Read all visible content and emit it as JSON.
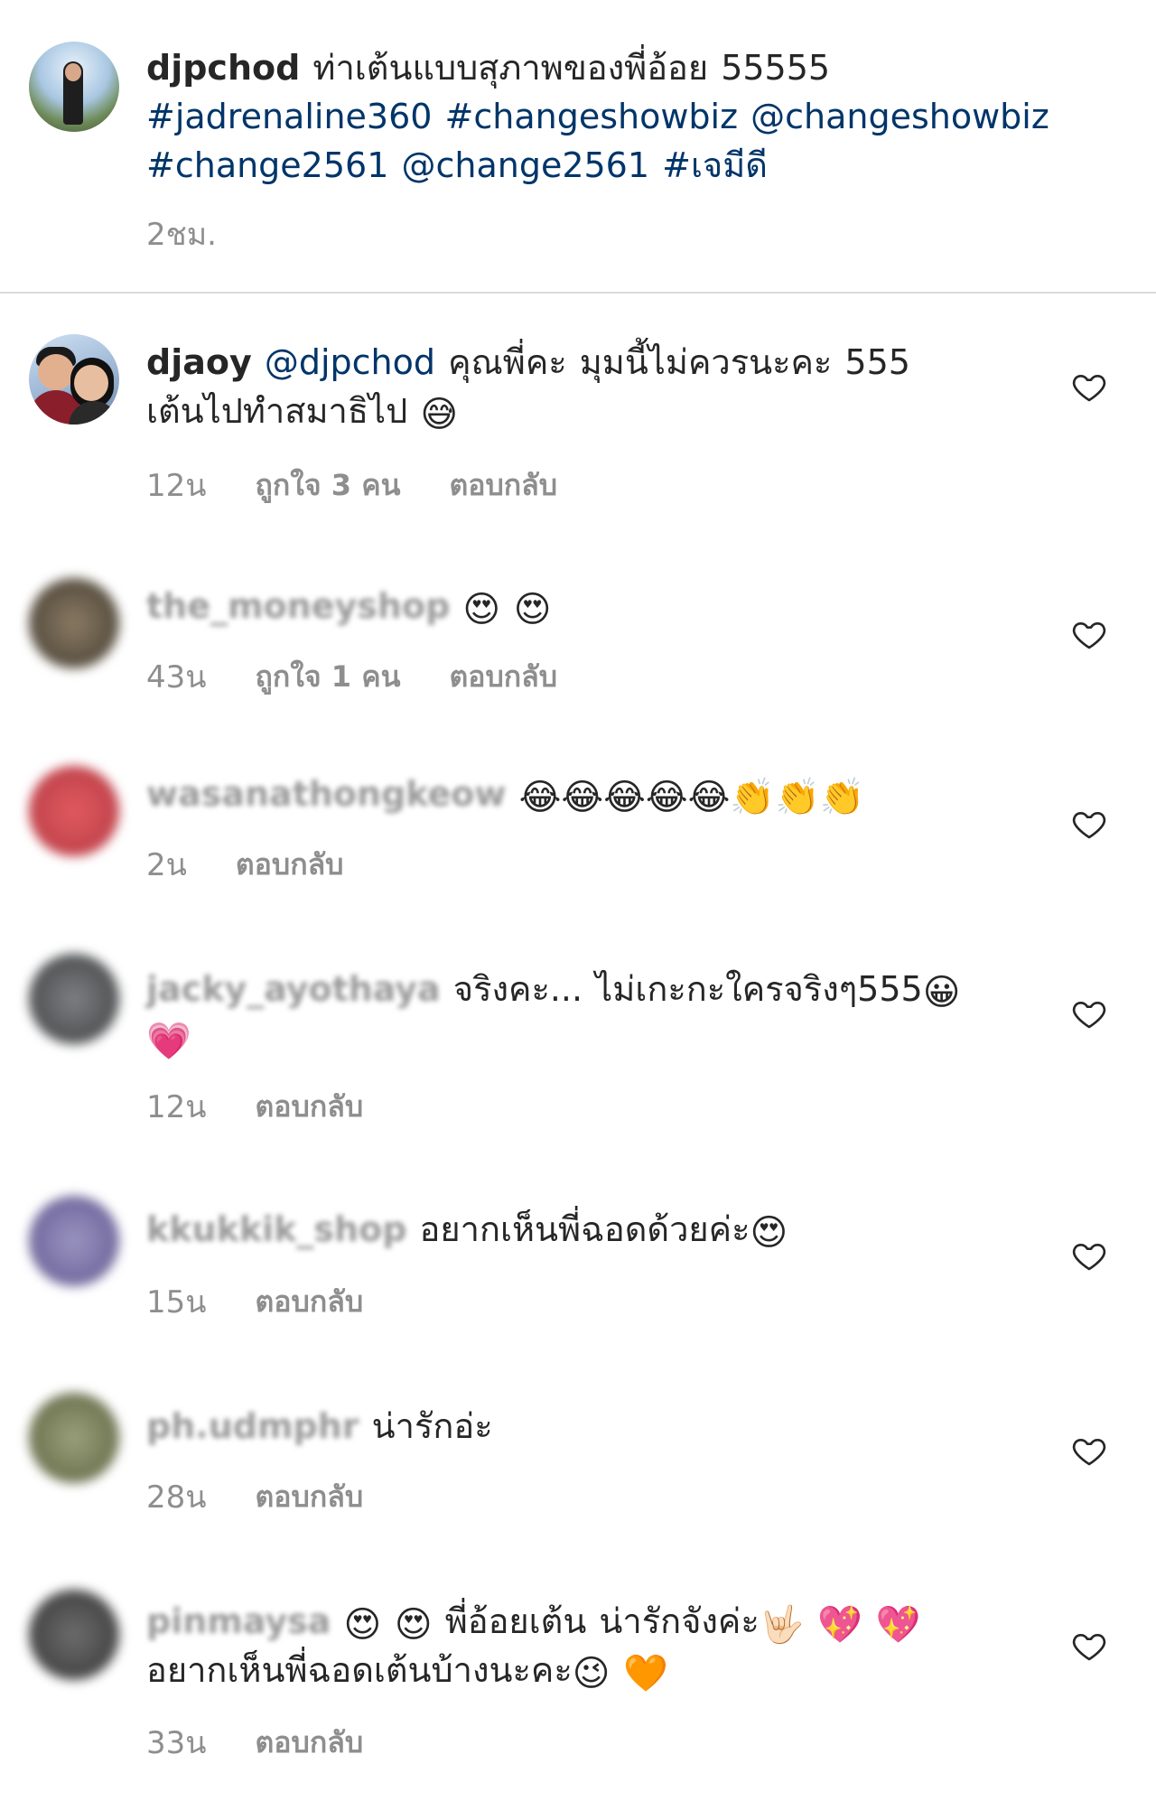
{
  "post": {
    "author": "djpchod",
    "caption_text": "ท่าเต้นแบบสุภาพของพี่อ้อย  55555",
    "tags_line1": "#jadrenaline360 #changeshowbiz @changeshowbiz",
    "tags_line2": "#change2561 @change2561 #เจมีดี",
    "time": "2ชม."
  },
  "comments": [
    {
      "username": "djaoy",
      "mention": "@djpchod",
      "text_line1": "คุณพี่คะ มุมนี้ไม่ควรนะคะ 555",
      "text_line2": "เต้นไปทำสมาธิไป",
      "emoji": "😅",
      "age": "12น",
      "likes": "ถูกใจ 3 คน",
      "reply": "ตอบกลับ"
    },
    {
      "username": "the_moneyshop",
      "emoji": "😍 😍",
      "age": "43น",
      "likes": "ถูกใจ 1 คน",
      "reply": "ตอบกลับ"
    },
    {
      "username": "wasanathongkeow",
      "emoji": "😂😂😂😂😂👏👏👏",
      "age": "2น",
      "reply": "ตอบกลับ"
    },
    {
      "username": "jacky_ayothaya",
      "text_line1": "จริงคะ... ไม่เกะกะใครจริงๆ555",
      "emoji": "😀",
      "emoji_line2": "💗",
      "age": "12น",
      "reply": "ตอบกลับ"
    },
    {
      "username": "kkukkik_shop",
      "text_line1": "อยากเห็นพี่ฉอดด้วยค่ะ",
      "emoji": "😍",
      "age": "15น",
      "reply": "ตอบกลับ"
    },
    {
      "username": "ph.udmphr",
      "text_line1": "น่ารักอ่ะ",
      "age": "28น",
      "reply": "ตอบกลับ"
    },
    {
      "username": "pinmaysa",
      "emoji_lead": "😍 😍",
      "text_line1": "พี่อ้อยเต้น น่ารักจังค่ะ",
      "emoji": "🤟🏻 💖 💖",
      "text_line2": "อยากเห็นพี่ฉอดเต้นบ้างนะคะ",
      "emoji_line2": "😉 🧡",
      "age": "33น",
      "reply": "ตอบกลับ"
    }
  ],
  "icons": {
    "like": "heart-outline-icon"
  },
  "colors": {
    "text": "#262626",
    "link": "#003569",
    "meta": "#8e8e8e",
    "divider": "#dbdbdb"
  }
}
